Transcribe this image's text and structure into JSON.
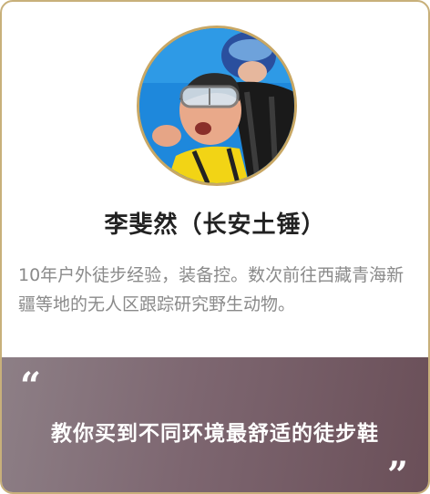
{
  "profile": {
    "avatar": "photo-skydiving-portrait",
    "name": "李斐然（长安土锤）",
    "bio": "10年户外徒步经验，装备控。数次前往西藏青海新疆等地的无人区跟踪研究野生动物。"
  },
  "quote": {
    "open_mark": "“",
    "text": "教你买到不同环境最舒适的徒步鞋",
    "close_mark": "”"
  },
  "colors": {
    "border": "#c8b07a",
    "name": "#222222",
    "bio": "#8a8a8a",
    "quote_bg_start": "#8d7f86",
    "quote_bg_end": "#6a4f58"
  }
}
